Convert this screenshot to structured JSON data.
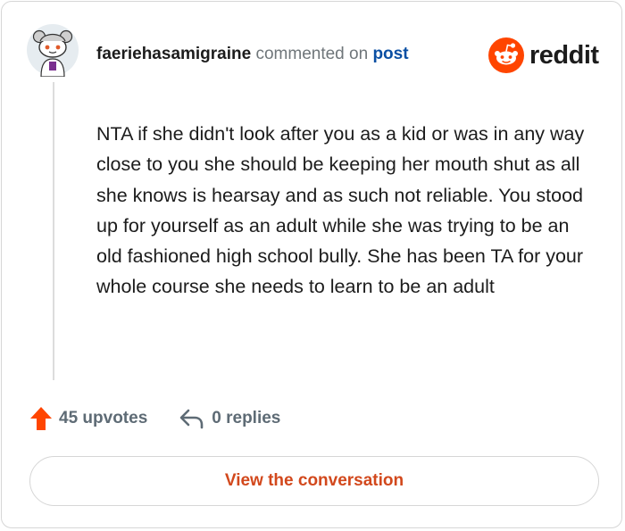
{
  "header": {
    "username": "faeriehasamigraine",
    "commented_on": "commented on",
    "post_link": "post",
    "brand": "reddit"
  },
  "comment": {
    "text": "NTA if she didn't look after you as a kid or was in any way close to you she should be keeping her mouth shut as all she knows is hearsay and as such not reliable. You stood up for yourself as an adult while she was trying to be an old fashioned high school bully. She has been TA for your whole course she needs to learn to be an adult"
  },
  "footer": {
    "upvotes": "45 upvotes",
    "replies": "0 replies"
  },
  "cta": {
    "label": "View the conversation"
  },
  "colors": {
    "accent": "#d2481c",
    "upvote": "#ff4500",
    "link": "#0a4fa3",
    "muted": "#5e6b75"
  },
  "icons": {
    "avatar": "snoo-avatar-icon",
    "logo": "reddit-logo-icon",
    "upvote": "upvote-arrow-icon",
    "reply": "reply-arrow-icon"
  }
}
